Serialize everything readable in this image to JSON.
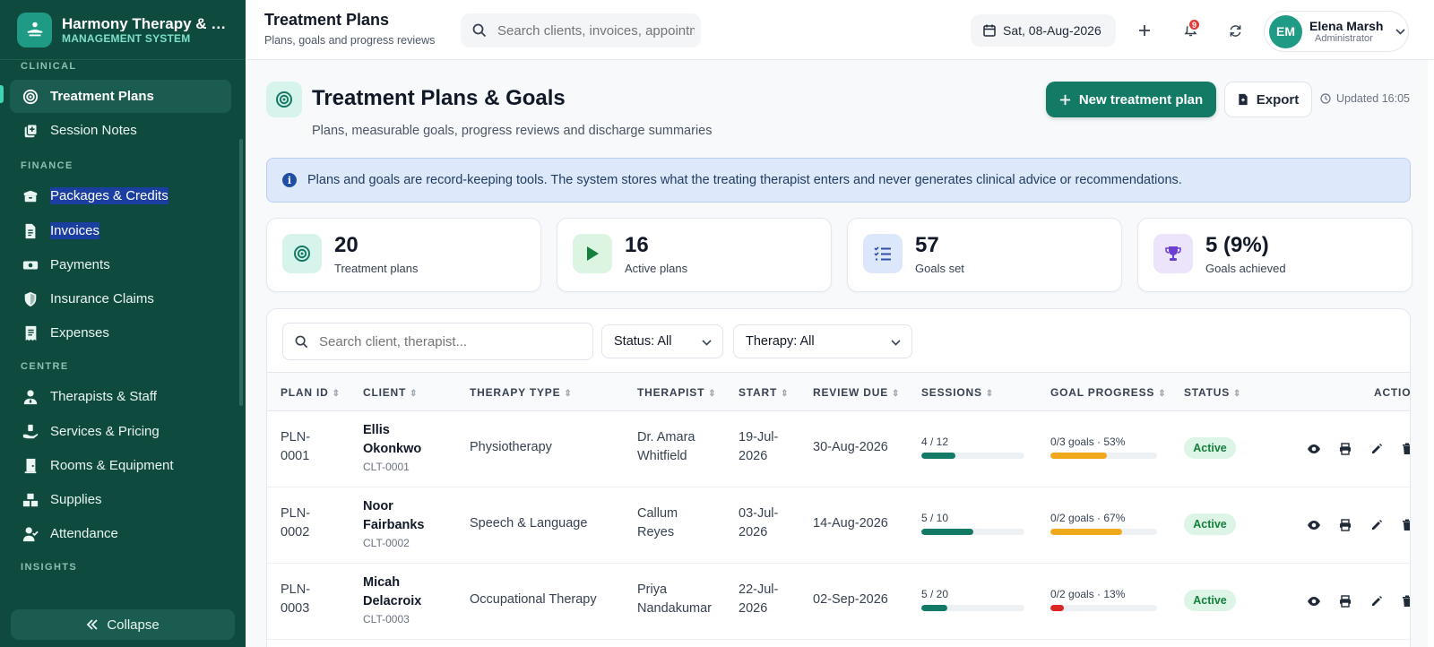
{
  "brand": {
    "name": "Harmony Therapy & Re...",
    "subtitle": "MANAGEMENT SYSTEM"
  },
  "sidebar": {
    "sections": [
      {
        "label": "CLINICAL"
      },
      {
        "label": "FINANCE"
      },
      {
        "label": "CENTRE"
      },
      {
        "label": "INSIGHTS"
      }
    ],
    "items": [
      {
        "label": "Treatment Plans",
        "icon": "target-icon"
      },
      {
        "label": "Session Notes",
        "icon": "note-add-icon"
      },
      {
        "label": "Packages & Credits",
        "icon": "package-icon"
      },
      {
        "label": "Invoices",
        "icon": "invoice-icon"
      },
      {
        "label": "Payments",
        "icon": "cash-icon"
      },
      {
        "label": "Insurance Claims",
        "icon": "shield-icon"
      },
      {
        "label": "Expenses",
        "icon": "receipt-icon"
      },
      {
        "label": "Therapists & Staff",
        "icon": "user-tie-icon"
      },
      {
        "label": "Services & Pricing",
        "icon": "hand-holding-icon"
      },
      {
        "label": "Rooms & Equipment",
        "icon": "door-icon"
      },
      {
        "label": "Supplies",
        "icon": "boxes-icon"
      },
      {
        "label": "Attendance",
        "icon": "user-check-icon"
      }
    ],
    "collapse_label": "Collapse"
  },
  "topbar": {
    "title": "Treatment Plans",
    "subtitle": "Plans, goals and progress reviews",
    "search_placeholder": "Search clients, invoices, appointments...",
    "date": "Sat, 08-Aug-2026",
    "notification_count": "9",
    "user": {
      "initials": "EM",
      "name": "Elena Marsh",
      "role": "Administrator"
    }
  },
  "page": {
    "title": "Treatment Plans & Goals",
    "subtitle": "Plans, measurable goals, progress reviews and discharge summaries",
    "new_button": "New treatment plan",
    "export_button": "Export",
    "updated": "Updated 16:05",
    "info": "Plans and goals are record-keeping tools. The system stores what the treating therapist enters and never generates clinical advice or recommendations."
  },
  "stats": [
    {
      "value": "20",
      "label": "Treatment plans",
      "icon": "target-icon",
      "bg": "#d6f3ec",
      "fg": "#137a66"
    },
    {
      "value": "16",
      "label": "Active plans",
      "icon": "play-icon",
      "bg": "#dcf5e2",
      "fg": "#15803d"
    },
    {
      "value": "57",
      "label": "Goals set",
      "icon": "list-check-icon",
      "bg": "#dde7fb",
      "fg": "#2f4fa8"
    },
    {
      "value": "5 (9%)",
      "label": "Goals achieved",
      "icon": "trophy-icon",
      "bg": "#ece4fb",
      "fg": "#6b3fd0"
    }
  ],
  "filters": {
    "search_placeholder": "Search client, therapist...",
    "status": "Status: All",
    "therapy": "Therapy: All"
  },
  "table": {
    "columns": [
      "PLAN ID",
      "CLIENT",
      "THERAPY TYPE",
      "THERAPIST",
      "START",
      "REVIEW DUE",
      "SESSIONS",
      "GOAL PROGRESS",
      "STATUS",
      "ACTIONS"
    ],
    "rows": [
      {
        "plan_id_a": "PLN-",
        "plan_id_b": "0001",
        "client_a": "Ellis",
        "client_b": "Okonkwo",
        "client_id": "CLT-0001",
        "therapy": "Physiotherapy",
        "therapist_a": "Dr. Amara",
        "therapist_b": "Whitfield",
        "start_a": "19-Jul-",
        "start_b": "2026",
        "review": "30-Aug-2026",
        "sessions": "4 / 12",
        "sessions_frac": 0.333,
        "goals": "0/3 goals · 53%",
        "goal_pct": 53,
        "goal_color": "#f0a81c",
        "status": "Active"
      },
      {
        "plan_id_a": "PLN-",
        "plan_id_b": "0002",
        "client_a": "Noor",
        "client_b": "Fairbanks",
        "client_id": "CLT-0002",
        "therapy": "Speech & Language",
        "therapist_a": "Callum",
        "therapist_b": "Reyes",
        "start_a": "03-Jul-",
        "start_b": "2026",
        "review": "14-Aug-2026",
        "sessions": "5 / 10",
        "sessions_frac": 0.5,
        "goals": "0/2 goals · 67%",
        "goal_pct": 67,
        "goal_color": "#f0a81c",
        "status": "Active"
      },
      {
        "plan_id_a": "PLN-",
        "plan_id_b": "0003",
        "client_a": "Micah",
        "client_b": "Delacroix",
        "client_id": "CLT-0003",
        "therapy": "Occupational Therapy",
        "therapist_a": "Priya",
        "therapist_b": "Nandakumar",
        "start_a": "22-Jul-",
        "start_b": "2026",
        "review": "02-Sep-2026",
        "sessions": "5 / 20",
        "sessions_frac": 0.25,
        "goals": "0/2 goals · 13%",
        "goal_pct": 13,
        "goal_color": "#dc2626",
        "status": "Active"
      }
    ]
  }
}
